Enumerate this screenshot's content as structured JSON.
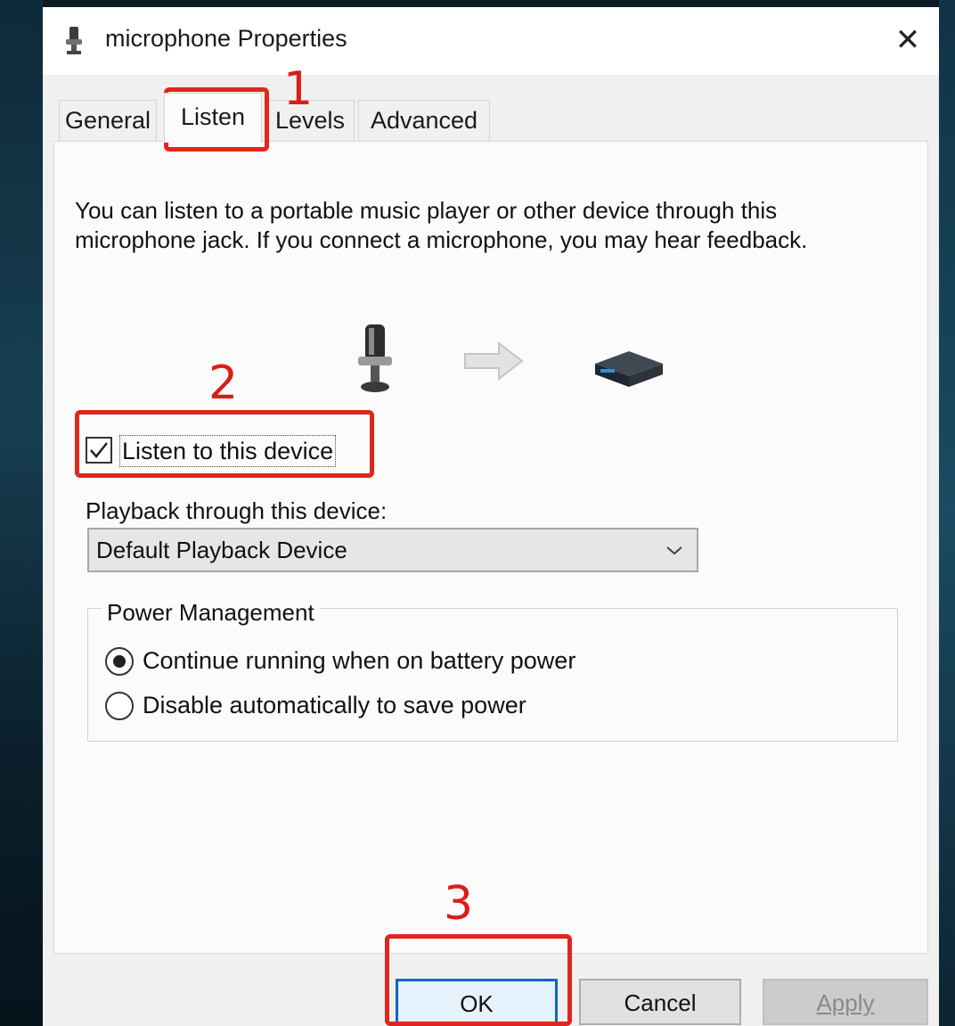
{
  "window": {
    "title": "microphone Properties",
    "close_glyph": "✕"
  },
  "tabs": [
    {
      "label": "General",
      "active": false
    },
    {
      "label": "Listen",
      "active": true
    },
    {
      "label": "Levels",
      "active": false
    },
    {
      "label": "Advanced",
      "active": false
    }
  ],
  "listen": {
    "description": "You can listen to a portable music player or other device through this microphone jack.  If you connect a microphone, you may hear feedback.",
    "listen_checkbox": {
      "label": "Listen to this device",
      "checked": true
    },
    "playback_label": "Playback through this device:",
    "playback_select": {
      "value": "Default Playback Device"
    }
  },
  "power": {
    "group_title": "Power Management",
    "options": [
      {
        "label": "Continue running when on battery power",
        "selected": true
      },
      {
        "label": "Disable automatically to save power",
        "selected": false
      }
    ]
  },
  "buttons": {
    "ok": "OK",
    "cancel": "Cancel",
    "apply": "Apply"
  },
  "annotations": {
    "step1": "1",
    "step2": "2",
    "step3": "3",
    "color": "#e0261f"
  }
}
